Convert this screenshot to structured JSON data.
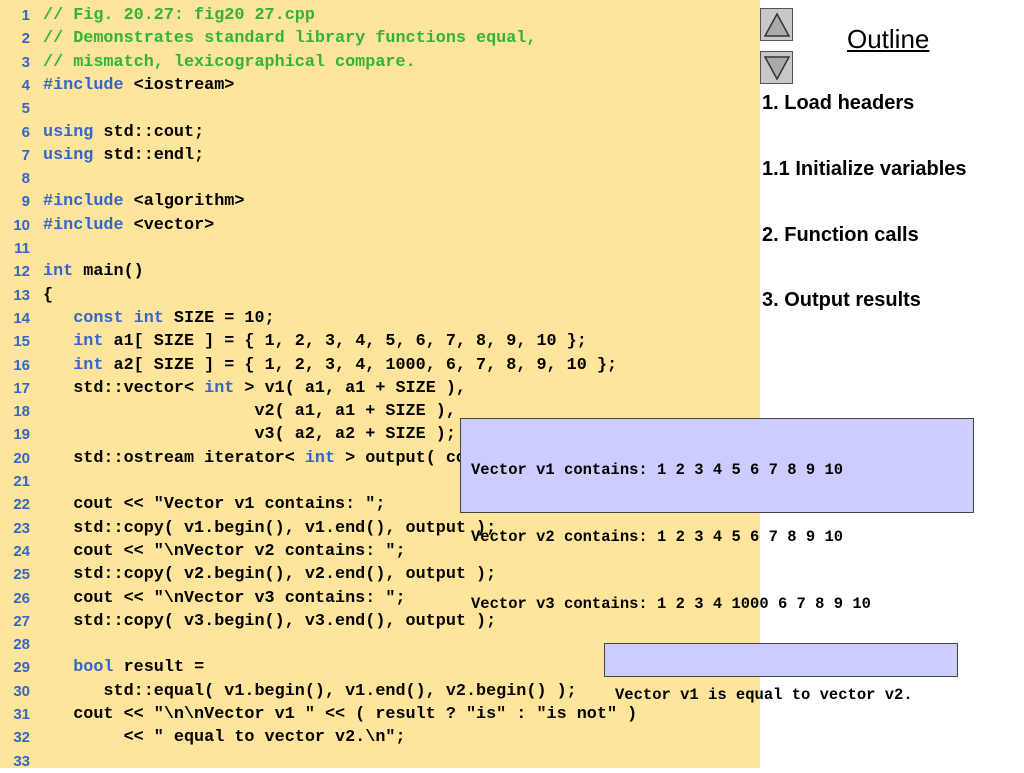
{
  "code": {
    "lines": [
      {
        "n": "1",
        "segs": [
          {
            "c": "comment",
            "t": "// Fig. 20.27: fig20 27.cpp"
          }
        ]
      },
      {
        "n": "2",
        "segs": [
          {
            "c": "comment",
            "t": "// Demonstrates standard library functions equal,"
          }
        ]
      },
      {
        "n": "3",
        "segs": [
          {
            "c": "comment",
            "t": "// mismatch, lexicographical compare."
          }
        ]
      },
      {
        "n": "4",
        "segs": [
          {
            "c": "kw",
            "t": "#include"
          },
          {
            "c": "plain",
            "t": " <iostream>"
          }
        ]
      },
      {
        "n": "5",
        "segs": []
      },
      {
        "n": "6",
        "segs": [
          {
            "c": "kw",
            "t": "using"
          },
          {
            "c": "plain",
            "t": " std::cout;"
          }
        ]
      },
      {
        "n": "7",
        "segs": [
          {
            "c": "kw",
            "t": "using"
          },
          {
            "c": "plain",
            "t": " std::endl;"
          }
        ]
      },
      {
        "n": "8",
        "segs": []
      },
      {
        "n": "9",
        "segs": [
          {
            "c": "kw",
            "t": "#include"
          },
          {
            "c": "plain",
            "t": " <algorithm>"
          }
        ]
      },
      {
        "n": "10",
        "segs": [
          {
            "c": "kw",
            "t": "#include"
          },
          {
            "c": "plain",
            "t": " <vector>"
          }
        ]
      },
      {
        "n": "11",
        "segs": []
      },
      {
        "n": "12",
        "segs": [
          {
            "c": "kw",
            "t": "int"
          },
          {
            "c": "plain",
            "t": " main()"
          }
        ]
      },
      {
        "n": "13",
        "segs": [
          {
            "c": "plain",
            "t": "{"
          }
        ]
      },
      {
        "n": "14",
        "segs": [
          {
            "c": "plain",
            "t": "   "
          },
          {
            "c": "kw",
            "t": "const int"
          },
          {
            "c": "plain",
            "t": " SIZE = 10;"
          }
        ]
      },
      {
        "n": "15",
        "segs": [
          {
            "c": "plain",
            "t": "   "
          },
          {
            "c": "kw",
            "t": "int"
          },
          {
            "c": "plain",
            "t": " a1[ SIZE ] = { 1, 2, 3, 4, 5, 6, 7, 8, 9, 10 };"
          }
        ]
      },
      {
        "n": "16",
        "segs": [
          {
            "c": "plain",
            "t": "   "
          },
          {
            "c": "kw",
            "t": "int"
          },
          {
            "c": "plain",
            "t": " a2[ SIZE ] = { 1, 2, 3, 4, 1000, 6, 7, 8, 9, 10 };"
          }
        ]
      },
      {
        "n": "17",
        "segs": [
          {
            "c": "plain",
            "t": "   std::vector< "
          },
          {
            "c": "kw",
            "t": "int"
          },
          {
            "c": "plain",
            "t": " > v1( a1, a1 + SIZE ),"
          }
        ]
      },
      {
        "n": "18",
        "segs": [
          {
            "c": "plain",
            "t": "                     v2( a1, a1 + SIZE ),"
          }
        ]
      },
      {
        "n": "19",
        "segs": [
          {
            "c": "plain",
            "t": "                     v3( a2, a2 + SIZE );"
          }
        ]
      },
      {
        "n": "20",
        "segs": [
          {
            "c": "plain",
            "t": "   std::ostream iterator< "
          },
          {
            "c": "kw",
            "t": "int"
          },
          {
            "c": "plain",
            "t": " > output( cout, \" \" );"
          }
        ]
      },
      {
        "n": "21",
        "segs": []
      },
      {
        "n": "22",
        "segs": [
          {
            "c": "plain",
            "t": "   cout << \"Vector v1 contains: \";"
          }
        ]
      },
      {
        "n": "23",
        "segs": [
          {
            "c": "plain",
            "t": "   std::copy( v1.begin(), v1.end(), output );"
          }
        ]
      },
      {
        "n": "24",
        "segs": [
          {
            "c": "plain",
            "t": "   cout << \"\\nVector v2 contains: \";"
          }
        ]
      },
      {
        "n": "25",
        "segs": [
          {
            "c": "plain",
            "t": "   std::copy( v2.begin(), v2.end(), output );"
          }
        ]
      },
      {
        "n": "26",
        "segs": [
          {
            "c": "plain",
            "t": "   cout << \"\\nVector v3 contains: \";"
          }
        ]
      },
      {
        "n": "27",
        "segs": [
          {
            "c": "plain",
            "t": "   std::copy( v3.begin(), v3.end(), output );"
          }
        ]
      },
      {
        "n": "28",
        "segs": []
      },
      {
        "n": "29",
        "segs": [
          {
            "c": "plain",
            "t": "   "
          },
          {
            "c": "kw",
            "t": "bool"
          },
          {
            "c": "plain",
            "t": " result ="
          }
        ]
      },
      {
        "n": "30",
        "segs": [
          {
            "c": "plain",
            "t": "      std::equal( v1.begin(), v1.end(), v2.begin() );"
          }
        ]
      },
      {
        "n": "31",
        "segs": [
          {
            "c": "plain",
            "t": "   cout << \"\\n\\nVector v1 \" << ( result ? \"is\" : \"is not\" )"
          }
        ]
      },
      {
        "n": "32",
        "segs": [
          {
            "c": "plain",
            "t": "        << \" equal to vector v2.\\n\";"
          }
        ]
      },
      {
        "n": "33",
        "segs": []
      }
    ]
  },
  "outline": {
    "title": "Outline",
    "items": [
      "1. Load headers",
      "1.1 Initialize variables",
      "2. Function calls",
      "3. Output results"
    ]
  },
  "output1": [
    "Vector v1 contains: 1 2 3 4 5 6 7 8 9 10",
    "Vector v2 contains: 1 2 3 4 5 6 7 8 9 10",
    "Vector v3 contains: 1 2 3 4 1000 6 7 8 9 10"
  ],
  "output2": "Vector v1 is equal to vector v2."
}
